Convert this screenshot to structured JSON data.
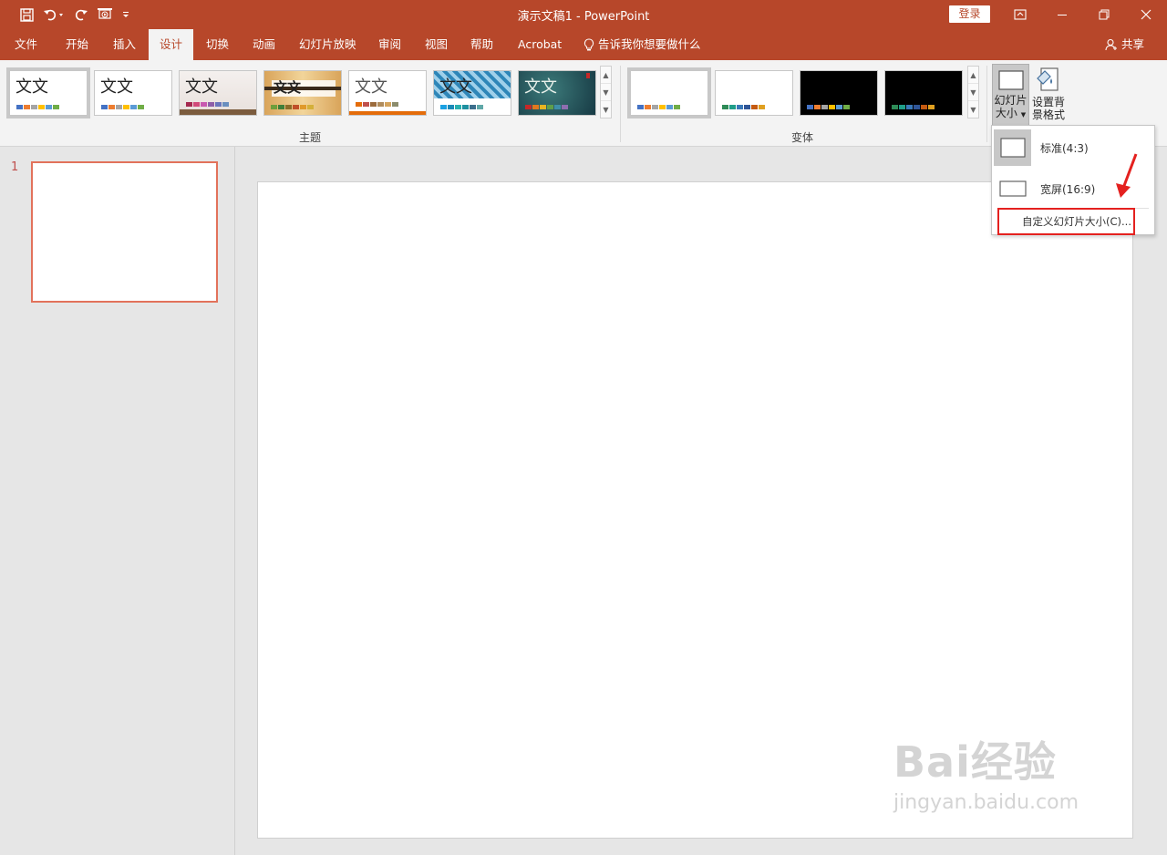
{
  "titlebar": {
    "title": "演示文稿1  -  PowerPoint",
    "login": "登录"
  },
  "tabs": [
    {
      "label": "文件"
    },
    {
      "label": "开始"
    },
    {
      "label": "插入"
    },
    {
      "label": "设计"
    },
    {
      "label": "切换"
    },
    {
      "label": "动画"
    },
    {
      "label": "幻灯片放映"
    },
    {
      "label": "审阅"
    },
    {
      "label": "视图"
    },
    {
      "label": "帮助"
    },
    {
      "label": "Acrobat"
    }
  ],
  "tellme": "告诉我你想要做什么",
  "share": "共享",
  "ribbon": {
    "themes_label": "主题",
    "variants_label": "变体",
    "theme_text": "文文",
    "slide_size_label_1": "幻灯片",
    "slide_size_label_2": "大小",
    "format_bg_label_1": "设置背",
    "format_bg_label_2": "景格式"
  },
  "slides": {
    "number": "1"
  },
  "dropdown": {
    "standard": "标准(4:3)",
    "widescreen": "宽屏(16:9)",
    "custom": "自定义幻灯片大小(C)..."
  },
  "watermark": {
    "big": "Bai经验",
    "small": "jingyan.baidu.com"
  },
  "colors": {
    "accent": "#b7472a",
    "highlight": "#e4211f",
    "slide_selected": "#e2725b"
  }
}
